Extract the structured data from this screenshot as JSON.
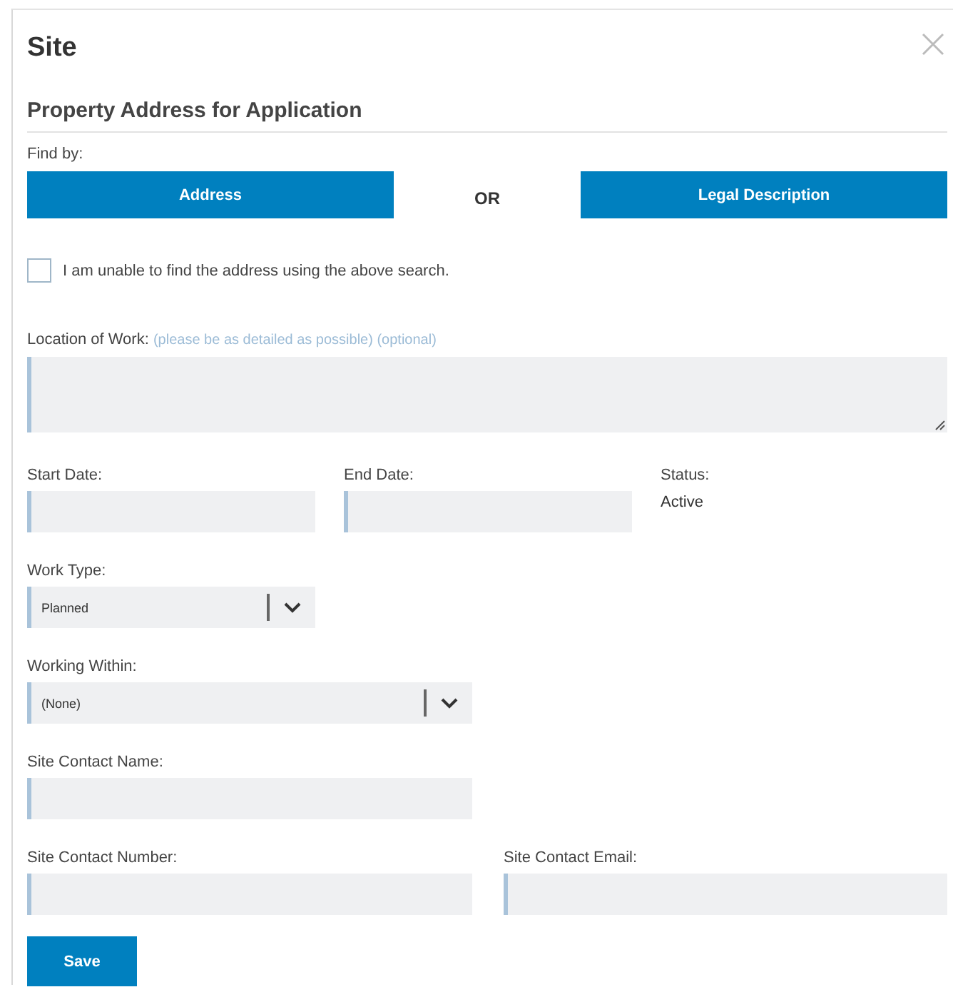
{
  "dialog": {
    "title": "Site"
  },
  "section": {
    "heading": "Property Address for Application"
  },
  "find_by": {
    "label": "Find by:",
    "buttons": [
      "Address",
      "Legal Description"
    ],
    "separator": "OR"
  },
  "unable_checkbox": {
    "label": "I am unable to find the address using the above search.",
    "checked": false
  },
  "location": {
    "label": "Location of Work:",
    "hint": "(please be as detailed as possible) (optional)"
  },
  "start_date": {
    "label": "Start Date:"
  },
  "end_date": {
    "label": "End Date:"
  },
  "status": {
    "label": "Status:",
    "value": "Active"
  },
  "work_type": {
    "label": "Work Type:",
    "value": "Planned"
  },
  "working_within": {
    "label": "Working Within:",
    "value": "(None)"
  },
  "contact_name": {
    "label": "Site Contact Name:"
  },
  "contact_number": {
    "label": "Site Contact Number:"
  },
  "contact_email": {
    "label": "Site Contact Email:"
  },
  "save_button": "Save"
}
